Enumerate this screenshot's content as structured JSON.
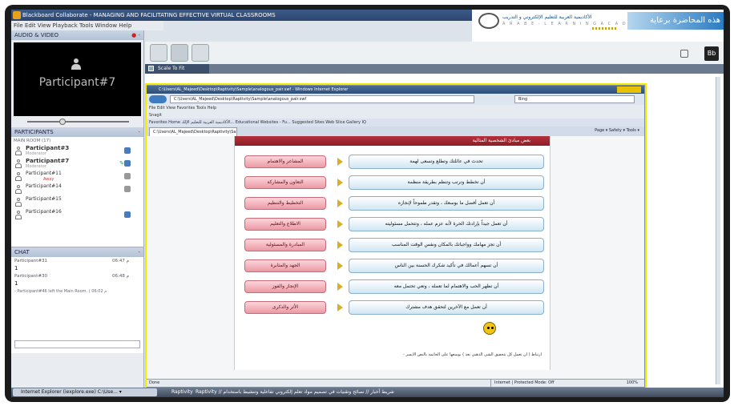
{
  "window": {
    "title": "Blackboard Collaborate - MANAGING AND FACILITATING EFFECTIVE VIRTUAL CLASSROOMS",
    "menu": "File  Edit  View  Playback  Tools  Window  Help"
  },
  "banner": {
    "arabic_caption": "هذه المحاضرة برعاية",
    "logo_text": "الأكاديمية العربية للتعليم الإلكتروني و التدريب",
    "logo_sub": "A R A B   E - L E A R N I N G   A C A D E M Y",
    "bb_label": "Bb"
  },
  "audio_video": {
    "header": "AUDIO & VIDEO",
    "participant_label": "Participant#7"
  },
  "participants": {
    "header": "PARTICIPANTS",
    "room": "MAIN ROOM (17)",
    "list": [
      {
        "name": "Participant#3",
        "role": "Moderator",
        "status": ""
      },
      {
        "name": "Participant#7",
        "role": "Moderator",
        "status": ""
      },
      {
        "name": "Participant#11",
        "role": "",
        "status": "Away"
      },
      {
        "name": "Participant#14",
        "role": "",
        "status": ""
      },
      {
        "name": "Participant#15",
        "role": "",
        "status": ""
      },
      {
        "name": "Participant#16",
        "role": "",
        "status": ""
      }
    ]
  },
  "chat": {
    "header": "CHAT",
    "messages": [
      {
        "from": "Participant#31",
        "time": "06:47 م",
        "text": "1"
      },
      {
        "from": "Participant#30",
        "time": "06:48 م",
        "text": "1"
      }
    ],
    "system": "- Participant#46 left the Main Room. ( 06:02 م"
  },
  "content": {
    "scale_label": "Scale To Fit"
  },
  "ie": {
    "title": "C:\\Users\\AL_Majeed\\Desktop\\Raptivity\\Sample\\analogous_pair.swf - Windows Internet Explorer",
    "url": "C:\\Users\\AL_Majeed\\Desktop\\Raptivity\\Sample\\analogous_pair.swf",
    "search": "Bing",
    "menu": "File   Edit   View   Favorites   Tools   Help",
    "snag": "Snagit",
    "favorites": "Favorites   Home   الأكاديمية العربية للتعليم الإلك...   Educational Websites - Fu...   Suggested Sites   Web Slice Gallery   IQ",
    "tab": "C:\\Users\\AL_Majeed\\Desktop\\Raptivity\\Sample\\...",
    "tools": "Page ▾  Safety ▾  Tools ▾",
    "status_left": "Done",
    "status_zone": "Internet | Protected Mode: Off",
    "zoom": "100%"
  },
  "activity": {
    "header": "بعض مبادئ الشخصية المثالية",
    "rows": [
      {
        "left": "المشاعر والاهتمام",
        "right": "تحدث في عائلتك وتطلع وتسعى لهمة"
      },
      {
        "left": "التعاون والمشاركة",
        "right": "أن تخطط وترتب وتنظم بطريقة منظمة"
      },
      {
        "left": "التخطيط والتنظيم",
        "right": "أن تعمل أفضل ما بوسعك ، وتقدر طموحاً لإنجازه"
      },
      {
        "left": "الاطلاع والتعليم",
        "right": "أن تعمل جيداً بإرادتك الحرة لأنه عزم عمله ، وتتحمل مسئوليته"
      },
      {
        "left": "المبادرة والمسئولية",
        "right": "أن تجز مهامك وواجباتك بالمكان ونفس الوقت المناسب"
      },
      {
        "left": "الجهد والمثابرة",
        "right": "أن تسهم أعمالك في تأكيد شكرك الحسنة بين الناس"
      },
      {
        "left": "الإنجاز والفوز",
        "right": "أن تظهر الحب والاهتمام لما تعمله ، وتعي تحتمل معه"
      },
      {
        "left": "الأثر والذكرى",
        "right": "أن تعمل مع الآخرين لتحقق هدف مشترك"
      }
    ],
    "footnote": "- ارتباط ( أن تعمل كل بتحقيق الشي الذهبي بعد ) بوسعها على الخاتمة بالنص الأيسر"
  },
  "taskbar": {
    "task": "Internet Explorer (iexplore.exe) C:\\Use... ▾",
    "label": "Raptivity",
    "ticker": "Raptivity // شريط أخبار // نصائح وتقنيات في تصميم مواد تعلم إلكتروني تفاعلية وتنشيط باستخدام"
  },
  "colors": {
    "accent": "#2b7bc2",
    "pink_button": "#ec9aa4",
    "blue_button": "#cfe6f3",
    "highlight": "#f2ea00"
  }
}
